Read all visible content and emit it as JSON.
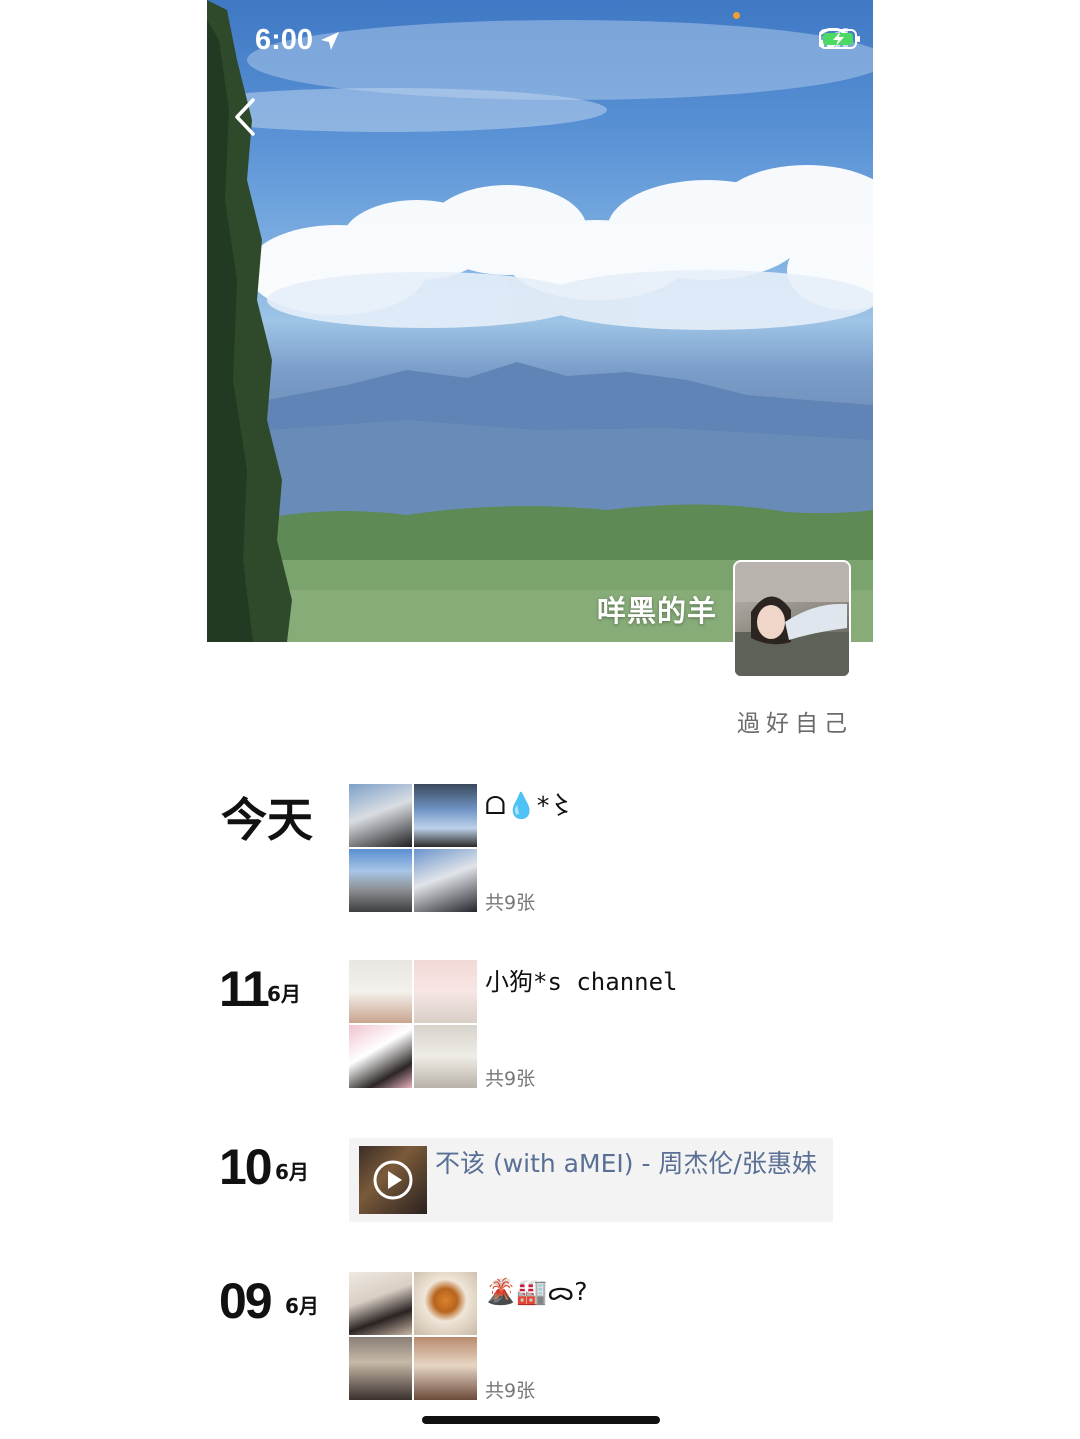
{
  "status_bar": {
    "time": "6:00"
  },
  "profile": {
    "name": "咩黑的羊",
    "signature": "過好自己"
  },
  "feed": [
    {
      "date_label": "今天",
      "text": "ᗝ💧*〻",
      "photo_count": "共9张"
    },
    {
      "day": "11",
      "month": "6月",
      "text": "小狗*s channel",
      "photo_count": "共9张"
    },
    {
      "day": "10",
      "month": "6月",
      "music_title": "不该 (with aMEI) - 周杰伦/张惠妹"
    },
    {
      "day": "09",
      "month": "6月",
      "text": "🌋🏭ᯅ?",
      "photo_count": "共9张"
    }
  ],
  "colors": {
    "link": "#5a6f95",
    "text": "#111111",
    "muted": "#777777"
  },
  "icons": {
    "back": "chevron-left-icon",
    "location": "location-arrow-icon",
    "signal": "cellular-signal-icon",
    "wifi": "wifi-icon",
    "battery": "battery-charging-icon",
    "play": "play-icon"
  }
}
